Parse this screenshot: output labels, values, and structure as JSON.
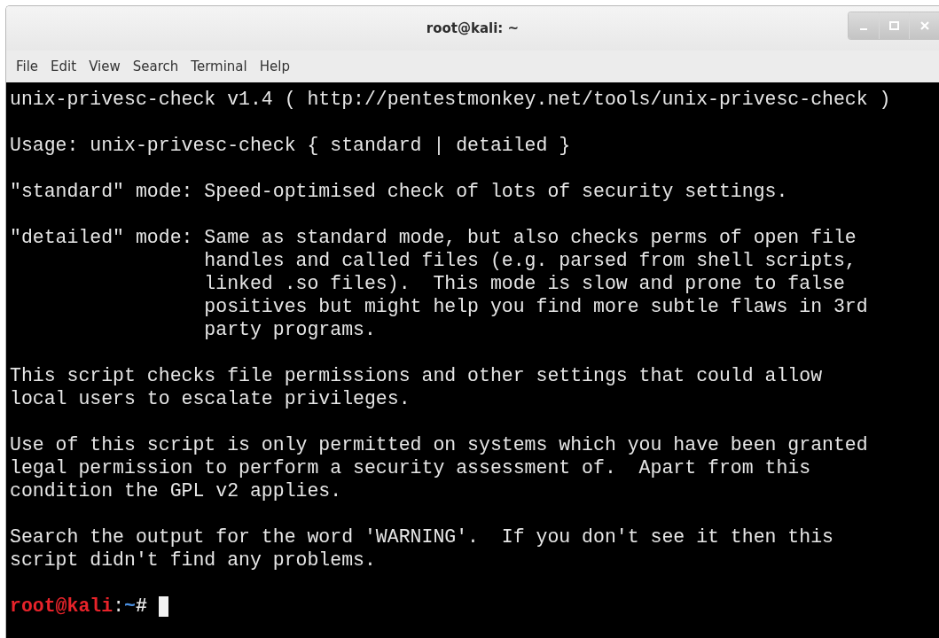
{
  "window": {
    "title": "root@kali: ~"
  },
  "menu": [
    "File",
    "Edit",
    "View",
    "Search",
    "Terminal",
    "Help"
  ],
  "terminal": {
    "paragraphs": [
      [
        "unix-privesc-check v1.4 ( http://pentestmonkey.net/tools/unix-privesc-check )"
      ],
      [
        "Usage: unix-privesc-check { standard | detailed }"
      ],
      [
        "\"standard\" mode: Speed-optimised check of lots of security settings."
      ],
      [
        "\"detailed\" mode: Same as standard mode, but also checks perms of open file",
        "                 handles and called files (e.g. parsed from shell scripts,",
        "                 linked .so files).  This mode is slow and prone to false",
        "                 positives but might help you find more subtle flaws in 3rd",
        "                 party programs."
      ],
      [
        "This script checks file permissions and other settings that could allow",
        "local users to escalate privileges."
      ],
      [
        "Use of this script is only permitted on systems which you have been granted",
        "legal permission to perform a security assessment of.  Apart from this",
        "condition the GPL v2 applies."
      ],
      [
        "Search the output for the word 'WARNING'.  If you don't see it then this",
        "script didn't find any problems."
      ]
    ],
    "prompt": {
      "user_host": "root@kali",
      "separator": ":",
      "path": "~",
      "symbol": "#"
    }
  }
}
